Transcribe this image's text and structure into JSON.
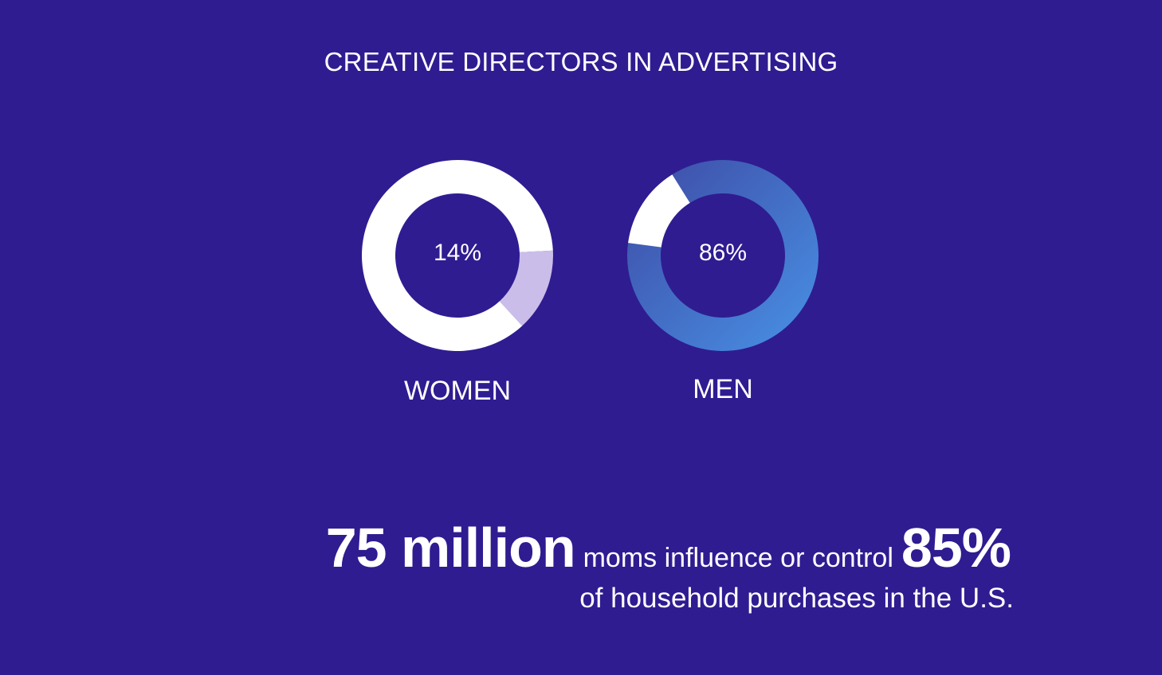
{
  "title": "CREATIVE DIRECTORS IN ADVERTISING",
  "chart_data": [
    {
      "type": "pie",
      "variant": "donut",
      "label": "WOMEN",
      "center_text": "14%",
      "values": [
        14,
        86
      ],
      "colors": [
        "#cbbde9",
        "#ffffff"
      ]
    },
    {
      "type": "pie",
      "variant": "donut",
      "label": "MEN",
      "center_text": "86%",
      "values": [
        86,
        14
      ],
      "colors": [
        "#4688e0",
        "#ffffff"
      ],
      "gradient": [
        "#3e4aa4",
        "#4892e6"
      ]
    }
  ],
  "stat": {
    "big1": "75 million",
    "mid": "moms influence or control",
    "big2": "85%",
    "line2": "of household purchases in the U.S."
  },
  "colors": {
    "background": "#2f1c91",
    "text": "#ffffff"
  }
}
